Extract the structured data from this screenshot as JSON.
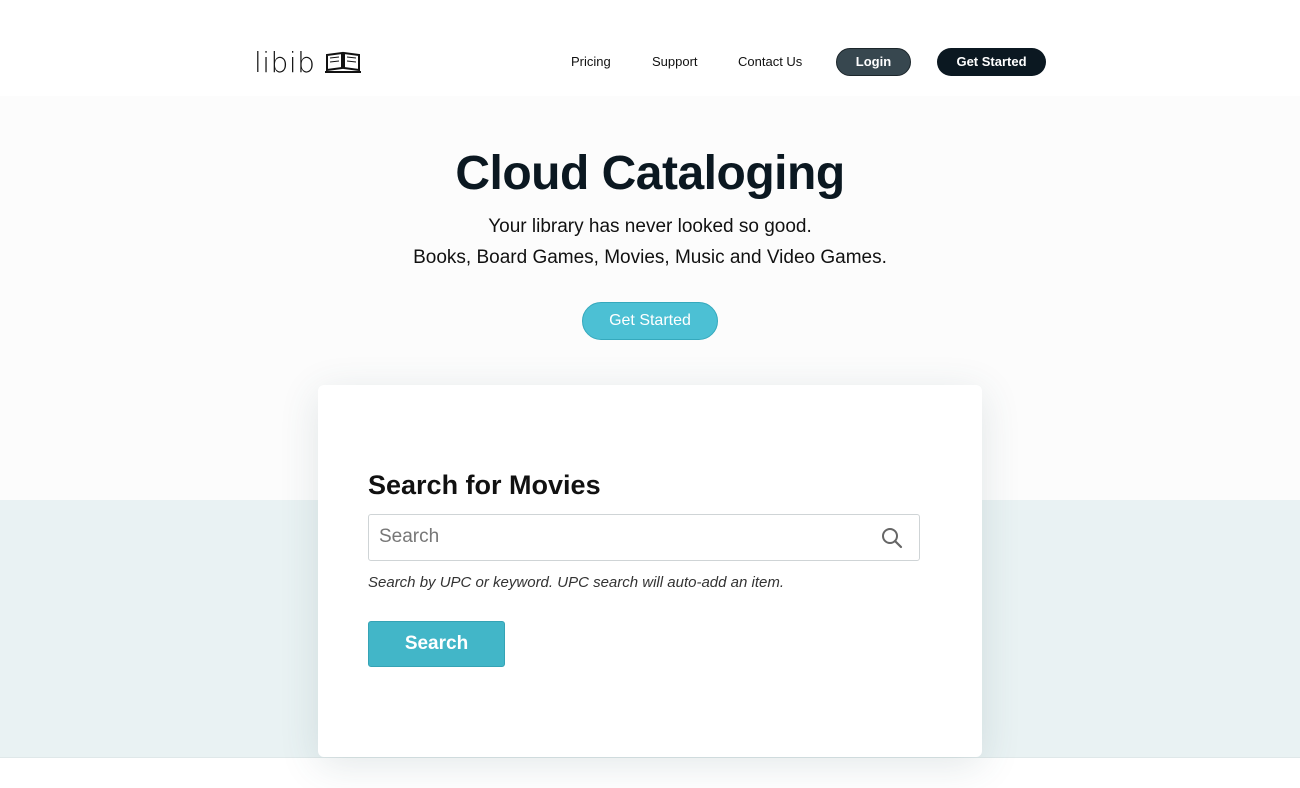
{
  "header": {
    "logo_text": "libib",
    "logo_icon": "open-book-icon",
    "nav": {
      "pricing": "Pricing",
      "support": "Support",
      "contact": "Contact Us"
    },
    "login_label": "Login",
    "get_started_label": "Get Started"
  },
  "hero": {
    "title": "Cloud Cataloging",
    "subtitle_line1": "Your library has never looked so good.",
    "subtitle_line2": "Books, Board Games, Movies, Music and Video Games.",
    "cta_label": "Get Started"
  },
  "search_card": {
    "title": "Search for Movies",
    "input_placeholder": "Search",
    "input_value": "",
    "search_icon": "magnifier-icon",
    "hint": "Search by UPC or keyword. UPC search will auto-add an item.",
    "button_label": "Search"
  },
  "colors": {
    "accent": "#42b6c8",
    "navy": "#0b1821",
    "login_gray": "#37474f",
    "band": "#e9f2f3"
  }
}
